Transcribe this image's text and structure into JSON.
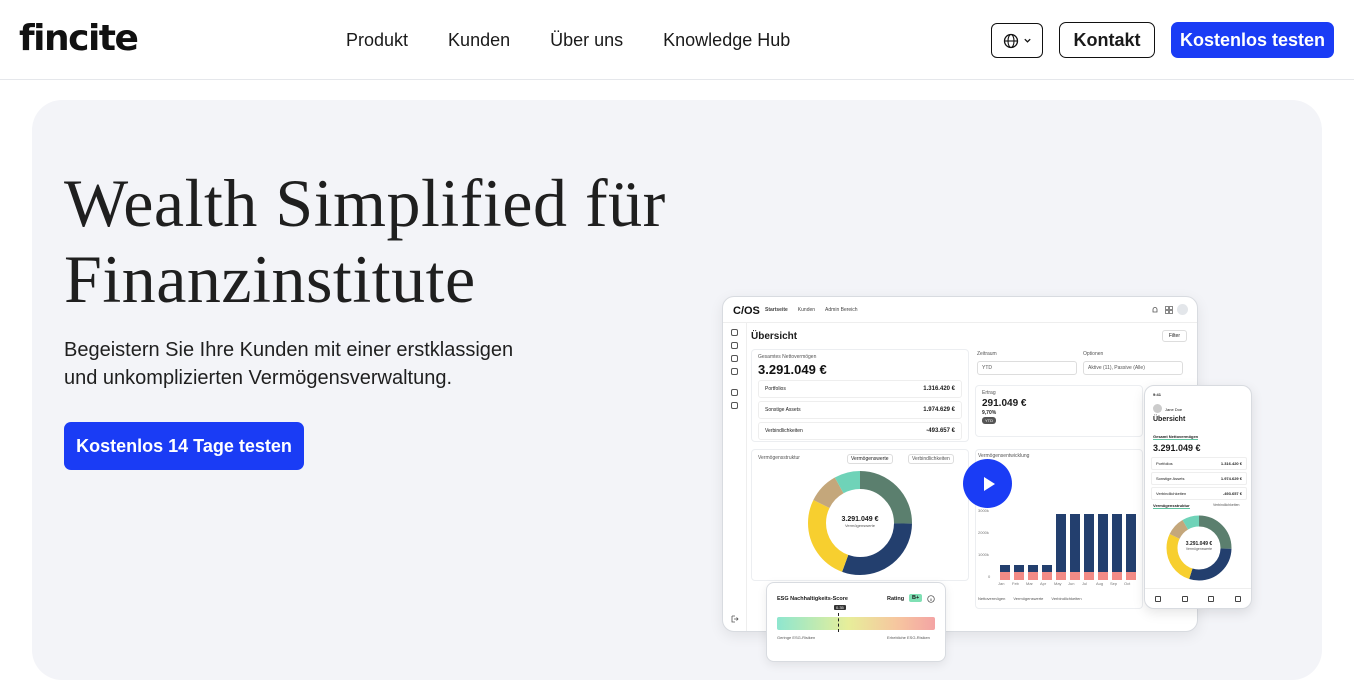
{
  "brand": {
    "logo": "fincite",
    "accent": "#1a3cf5"
  },
  "nav": {
    "links": [
      "Produkt",
      "Kunden",
      "Über uns",
      "Knowledge Hub"
    ],
    "language_icon": "globe-icon",
    "contact_label": "Kontakt",
    "trial_label": "Kostenlos testen"
  },
  "hero": {
    "title_line1": "Wealth Simplified für",
    "title_line2": "Finanzinstitute",
    "subtitle_line1": "Begeistern Sie Ihre Kunden mit einer erstklassigen",
    "subtitle_line2": "und unkomplizierten Vermögensverwaltung.",
    "cta_label": "Kostenlos 14 Tage testen"
  },
  "dashboard": {
    "logo": "C/OS",
    "tabs": [
      "Startseite",
      "Kunden",
      "Admin Bereich"
    ],
    "heading": "Übersicht",
    "filter": "Filter",
    "net_label": "Gesamtes Nettovermögen",
    "net_value": "3.291.049 €",
    "rows": [
      {
        "label": "Portfolios",
        "value": "1.316.420 €"
      },
      {
        "label": "Sonstige Assets",
        "value": "1.974.629 €"
      },
      {
        "label": "Verbindlichkeiten",
        "value": "-493.657 €"
      }
    ],
    "period_label": "Zeitraum",
    "period_value": "YTD",
    "options_label": "Optionen",
    "options_value": "Aktive (11), Passive (Alle)",
    "yield_label": "Ertrag",
    "yield_value": "291.049 €",
    "yield_pct": "9,70%",
    "yield_tag": "YTD",
    "structure_label": "Vermögensstruktur",
    "structure_tab1": "Vermögenswerte",
    "structure_tab2": "Verbindlichkeiten",
    "donut_value": "3.291.049 €",
    "donut_label": "Vermögenswerte",
    "development_label": "Vermögensentwicklung",
    "y_ticks": [
      "3000k",
      "2000k",
      "1000k",
      "0"
    ],
    "months": [
      "Jan",
      "Feb",
      "Mar",
      "Apr",
      "May",
      "Jun",
      "Jul",
      "Aug",
      "Sep",
      "Oct"
    ],
    "legend": [
      "Nettovermögen",
      "Vermögenswerte",
      "Verbindlichkeiten"
    ]
  },
  "phone": {
    "time": "9:41",
    "user": "Jane Doe",
    "heading": "Übersicht",
    "net_label": "Gesamt Nettovermögen",
    "net_value": "3.291.049 €",
    "rows": [
      {
        "label": "Portfolios",
        "value": "1.316.420 €"
      },
      {
        "label": "Sonstige Assets",
        "value": "1.974.629 €"
      },
      {
        "label": "Verbindlichkeiten",
        "value": "-493.657 €"
      }
    ],
    "structure_label": "Vermögensstruktur",
    "structure_tab": "Verbindlichkeiten",
    "donut_value": "3.291.049 €",
    "donut_label": "Vermögenswerte"
  },
  "esg": {
    "title": "ESG Nachhaltigkeits-Score",
    "rating_label": "Rating",
    "rating_value": "B+",
    "marker": "0.35",
    "low": "Geringe ESG-Risiken",
    "high": "Erhebliche ESG-Risiken"
  },
  "colors": {
    "navy": "#233f6e",
    "green": "#5b7f6e",
    "yellow": "#f7cf2f",
    "tan": "#c4a77b",
    "teal": "#6fd3b8",
    "red": "#f28b86"
  }
}
